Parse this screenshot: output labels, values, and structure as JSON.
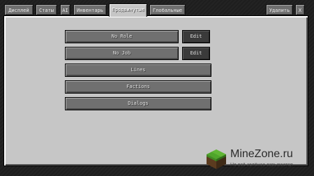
{
  "tabs": [
    {
      "label": "Дисплей",
      "active": false
    },
    {
      "label": "Статы",
      "active": false
    },
    {
      "label": "AI",
      "active": false
    },
    {
      "label": "Инвентарь",
      "active": false
    },
    {
      "label": "Продвинутые",
      "active": true
    },
    {
      "label": "Глобальные",
      "active": false
    }
  ],
  "top_right": {
    "delete_label": "Удалить",
    "close_label": "X"
  },
  "advanced": {
    "role_label": "No Role",
    "role_edit_label": "Edit",
    "job_label": "No Job",
    "job_edit_label": "Edit",
    "lines_label": "Lines",
    "factions_label": "Factions",
    "dialogs_label": "Dialogs"
  },
  "watermark": {
    "title": "MineZone.ru",
    "subtitle": "Не всё зелёное взрывается",
    "logo_icon": "grass-block-icon"
  },
  "colors": {
    "panel": "#c6c6c6",
    "button": "#707070",
    "button_dark": "#3a3a3a",
    "text": "#e0e0e0",
    "watermark_green": "#3a9b1f"
  }
}
